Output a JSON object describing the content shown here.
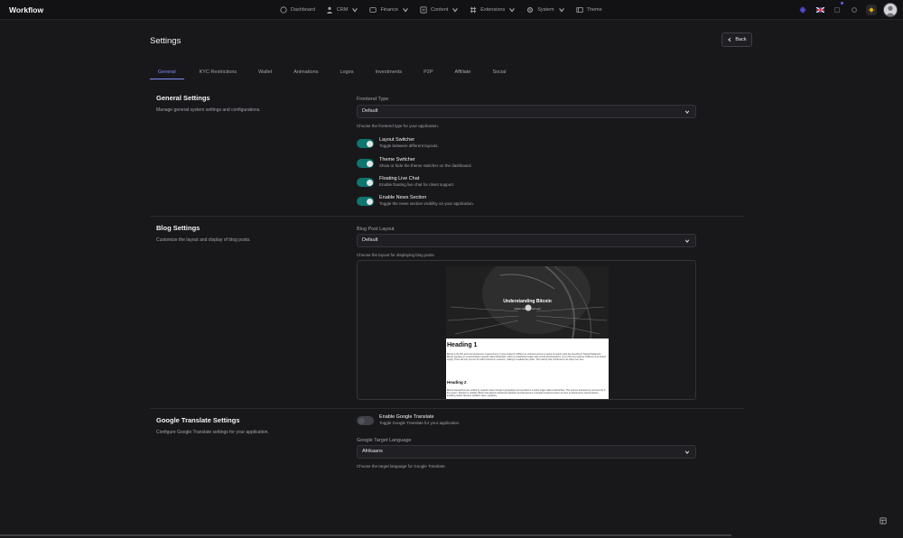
{
  "app": {
    "brand": "Workflow"
  },
  "nav": [
    {
      "label": "Dashboard",
      "icon": "home-icon",
      "has_menu": false
    },
    {
      "label": "CRM",
      "icon": "user-icon",
      "has_menu": true
    },
    {
      "label": "Finance",
      "icon": "dollar-icon",
      "has_menu": true
    },
    {
      "label": "Content",
      "icon": "document-icon",
      "has_menu": true
    },
    {
      "label": "Extensions",
      "icon": "grid-icon",
      "has_menu": true
    },
    {
      "label": "System",
      "icon": "gear-icon",
      "has_menu": true
    },
    {
      "label": "Theme",
      "icon": "palette-icon",
      "has_menu": false
    }
  ],
  "header_icons": [
    "globe-icon",
    "uk-flag-icon",
    "notification-icon",
    "settings-icon",
    "sun-icon",
    "avatar"
  ],
  "page": {
    "title": "Settings",
    "back_label": "Back"
  },
  "tabs": [
    {
      "label": "General",
      "active": true
    },
    {
      "label": "KYC Restrictions",
      "active": false
    },
    {
      "label": "Wallet",
      "active": false
    },
    {
      "label": "Animations",
      "active": false
    },
    {
      "label": "Logos",
      "active": false
    },
    {
      "label": "Investments",
      "active": false
    },
    {
      "label": "P2P",
      "active": false
    },
    {
      "label": "Affiliate",
      "active": false
    },
    {
      "label": "Social",
      "active": false
    }
  ],
  "general": {
    "title": "General Settings",
    "desc": "Manage general system settings and configurations.",
    "frontend_label": "Frontend Type",
    "frontend_value": "Default",
    "frontend_hint": "Choose the frontend type for your application.",
    "toggles": [
      {
        "title": "Layout Switcher",
        "desc": "Toggle between different layouts.",
        "on": true
      },
      {
        "title": "Theme Switcher",
        "desc": "Show or hide the theme switcher on the dashboard.",
        "on": true
      },
      {
        "title": "Floating Live Chat",
        "desc": "Enable floating live chat for client support.",
        "on": true
      },
      {
        "title": "Enable News Section",
        "desc": "Toggle the news section visibility on your application.",
        "on": true
      }
    ]
  },
  "blog": {
    "title": "Blog Settings",
    "desc": "Customize the layout and display of blog posts.",
    "layout_label": "Blog Post Layout",
    "layout_value": "Default",
    "layout_hint": "Choose the layout for displaying blog posts",
    "preview": {
      "hero_title": "Understanding Bitcoin",
      "hero_meta": "Author Name · 5 min read",
      "heading1": "Heading 1",
      "para1": "Bitcoin is the first and most well-known cryptocurrency. It was created in 2009 by an unknown person or group of people using the pseudonym Satoshi Nakamoto. Bitcoin operates on a decentralized network called blockchain, which is a distributed ledger that records all transactions. One of the key features of Bitcoin is its limited supply. There will only ever be 21 million bitcoins in existence, making it a deflationary asset. This scarcity has contributed to its value over time.",
      "heading2": "Heading 2",
      "para2": "Bitcoin transactions are verified by network nodes through cryptography and recorded in a public ledger called a blockchain. This ensures transparency and security in the system. Despite its volatility, Bitcoin has gained mainstream adoption and has become a popular investment asset. Its price is influenced by various factors including market demand, adoption rates, regulatory."
    }
  },
  "translate": {
    "title": "Google Translate Settings",
    "desc": "Configure Google Translate settings for your application.",
    "toggle_title": "Enable Google Translate",
    "toggle_desc": "Toggle Google Translate for your application.",
    "toggle_on": false,
    "lang_label": "Google Target Language",
    "lang_value": "Afrikaans",
    "lang_hint": "Choose the target language for Google Translate."
  }
}
